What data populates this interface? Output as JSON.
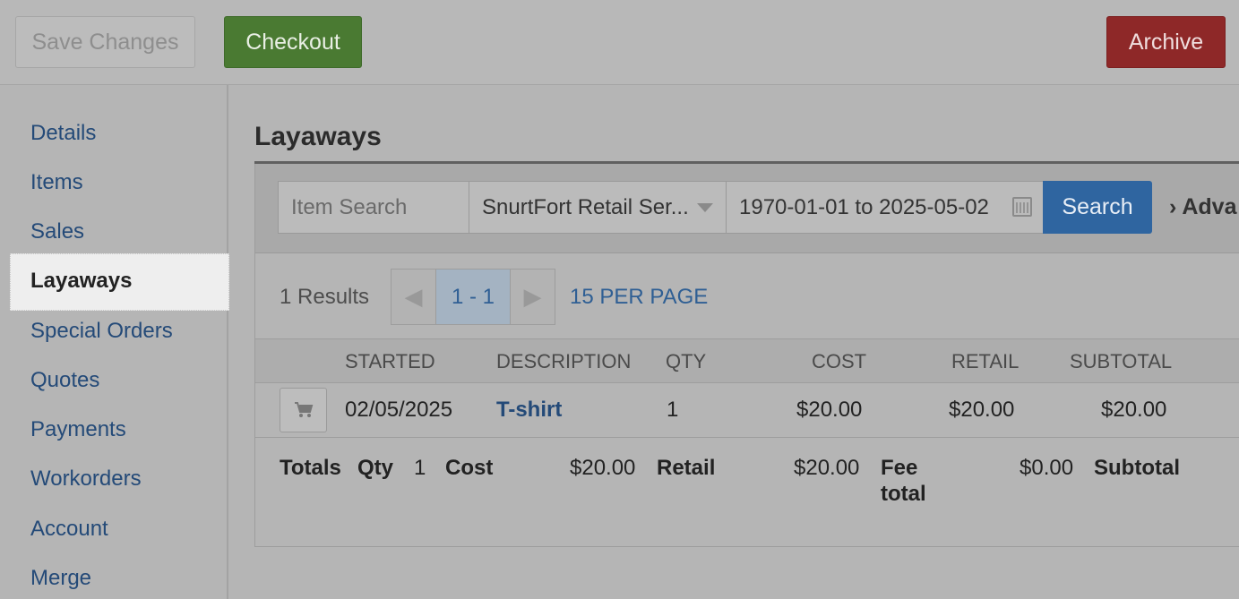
{
  "toolbar": {
    "save_label": "Save Changes",
    "checkout_label": "Checkout",
    "archive_label": "Archive"
  },
  "sidebar": {
    "items": [
      {
        "label": "Details"
      },
      {
        "label": "Items"
      },
      {
        "label": "Sales"
      },
      {
        "label": "Layaways"
      },
      {
        "label": "Special Orders"
      },
      {
        "label": "Quotes"
      },
      {
        "label": "Payments"
      },
      {
        "label": "Workorders"
      },
      {
        "label": "Account"
      },
      {
        "label": "Merge"
      }
    ],
    "active": "Layaways"
  },
  "main": {
    "title": "Layaways",
    "search": {
      "placeholder": "Item Search",
      "shop_value": "SnurtFort Retail Ser...",
      "date_range": "1970-01-01 to 2025-05-02",
      "search_label": "Search",
      "advanced_label": "Adva"
    },
    "results_text": "1 Results",
    "pager": {
      "current": "1 - 1"
    },
    "per_page": "15 PER PAGE",
    "table": {
      "headers": [
        "STARTED",
        "DESCRIPTION",
        "QTY",
        "COST",
        "RETAIL",
        "SUBTOTAL"
      ],
      "rows": [
        {
          "started": "02/05/2025",
          "description": "T-shirt",
          "qty": "1",
          "cost": "$20.00",
          "retail": "$20.00",
          "subtotal": "$20.00"
        }
      ]
    },
    "totals": {
      "label": "Totals",
      "qty_label": "Qty",
      "qty": "1",
      "cost_label": "Cost",
      "cost": "$20.00",
      "retail_label": "Retail",
      "retail": "$20.00",
      "fee_label_1": "Fee",
      "fee_label_2": "total",
      "fee": "$0.00",
      "subtotal_label": "Subtotal"
    }
  },
  "icons": {
    "cart": "cart-icon",
    "calendar": "calendar-icon",
    "dropdown": "chevron-down-icon",
    "prev": "chevron-left-icon",
    "next": "chevron-right-icon",
    "advanced": "chevron-right-icon"
  },
  "colors": {
    "checkout": "#4a7a32",
    "archive": "#8e2828",
    "search": "#2f65a0",
    "link": "#244a78"
  }
}
